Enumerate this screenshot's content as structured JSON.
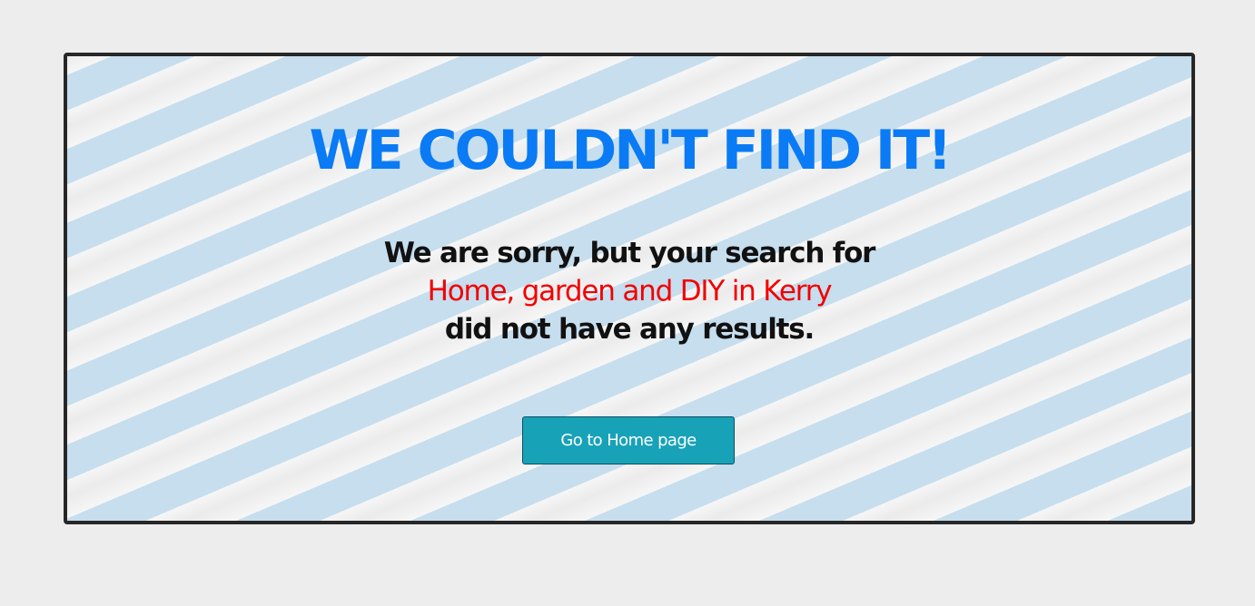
{
  "heading": "WE COULDN'T FIND IT!",
  "message": {
    "line1": "We are sorry, but your search for",
    "query": "Home, garden and DIY in Kerry",
    "line3": "did not have any results."
  },
  "button": {
    "label": "Go to Home page"
  },
  "colors": {
    "heading": "#0a7bf4",
    "query": "#f20000",
    "button": "#17a2b8",
    "stripe": "#c6deee",
    "page_background": "#ededed",
    "panel_border": "#272727"
  }
}
